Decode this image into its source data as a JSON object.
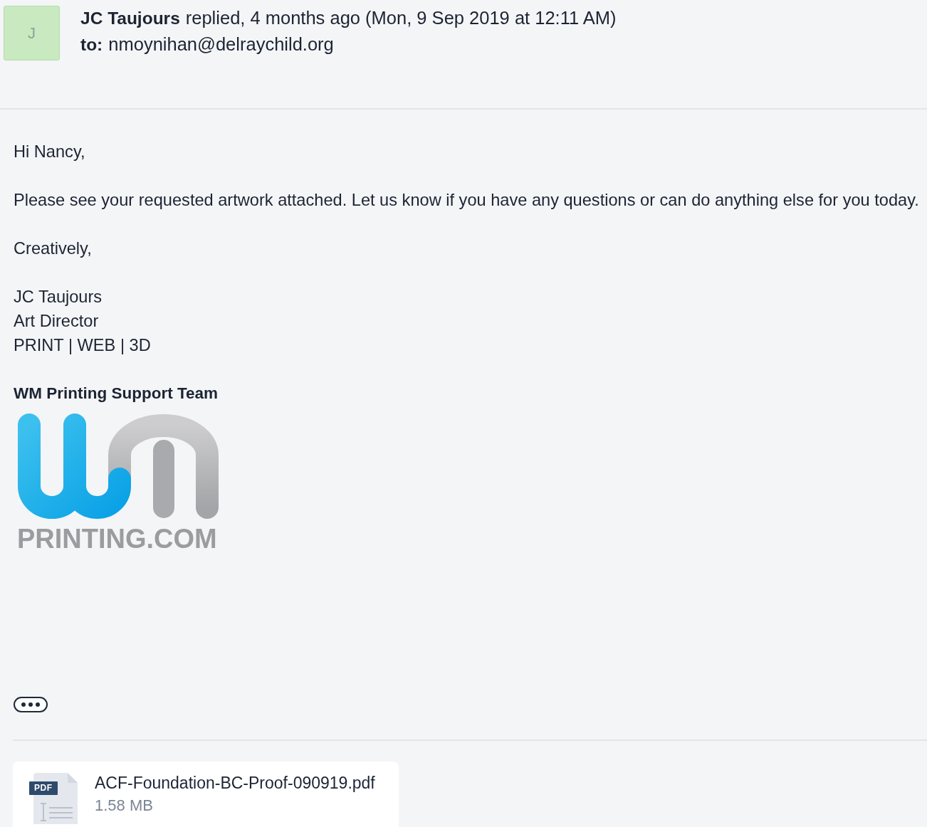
{
  "message_header": {
    "avatar": {
      "initial": "J"
    },
    "sender": "JC Taujours",
    "action": "replied, 4 months ago (Mon, 9 Sep 2019 at 12:11 AM)",
    "recipient_label": "to:",
    "recipient": "nmoynihan@delraychild.org"
  },
  "body": {
    "paragraphs": [
      "Hi Nancy,",
      "Please see your requested artwork attached. Let us know if you have any questions or can do anything else for you today.",
      "Creatively,"
    ],
    "signature_lines": [
      "JC Taujours",
      "Art Director",
      "PRINT | WEB | 3D"
    ],
    "team": "WM Printing Support Team",
    "logo": {
      "wordmark": "PRINTING.COM"
    }
  },
  "attachments": [
    {
      "type_label": "PDF",
      "name": "ACF-Foundation-BC-Proof-090919.pdf",
      "size": "1.58 MB"
    }
  ]
}
